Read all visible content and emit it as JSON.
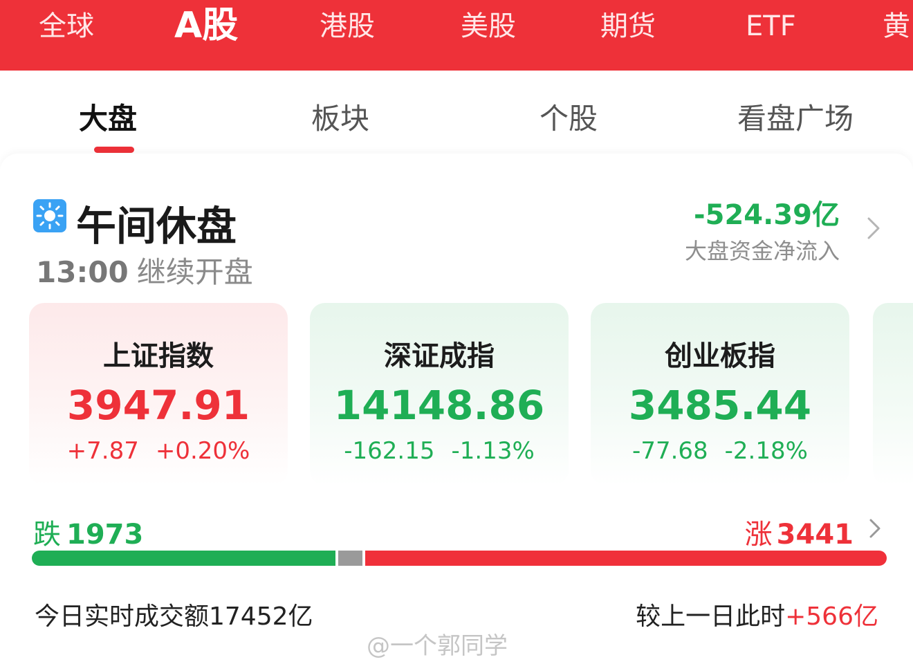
{
  "market_tabs": [
    "全球",
    "A股",
    "港股",
    "美股",
    "期货",
    "ETF",
    "黄"
  ],
  "sub_tabs": [
    "大盘",
    "板块",
    "个股",
    "看盘广场"
  ],
  "session": {
    "title": "午间休盘",
    "resume_time": "13:00",
    "resume_text": "继续开盘",
    "icon": "sun-icon"
  },
  "fund_flow": {
    "value": "-524.39亿",
    "label": "大盘资金净流入"
  },
  "indices": [
    {
      "name": "上证指数",
      "price": "3947.91",
      "change": "+7.87",
      "percent": "+0.20%",
      "trend": "up"
    },
    {
      "name": "深证成指",
      "price": "14148.86",
      "change": "-162.15",
      "percent": "-1.13%",
      "trend": "down"
    },
    {
      "name": "创业板指",
      "price": "3485.44",
      "change": "-77.68",
      "percent": "-2.18%",
      "trend": "down"
    }
  ],
  "breadth": {
    "fall_label": "跌",
    "fall_count": "1973",
    "rise_label": "涨",
    "rise_count": "3441",
    "fall_fraction": 0.355,
    "flat_fraction": 0.028,
    "rise_fraction": 0.617
  },
  "turnover": {
    "text": "今日实时成交额17452亿",
    "compare_label": "较上一日此时",
    "compare_delta": "+566亿"
  },
  "watermark": "@一个郭同学",
  "colors": {
    "accent_red": "#ee3139",
    "up_red": "#ee3139",
    "down_green": "#1fae55",
    "flat_gray": "#9a9a9a"
  }
}
